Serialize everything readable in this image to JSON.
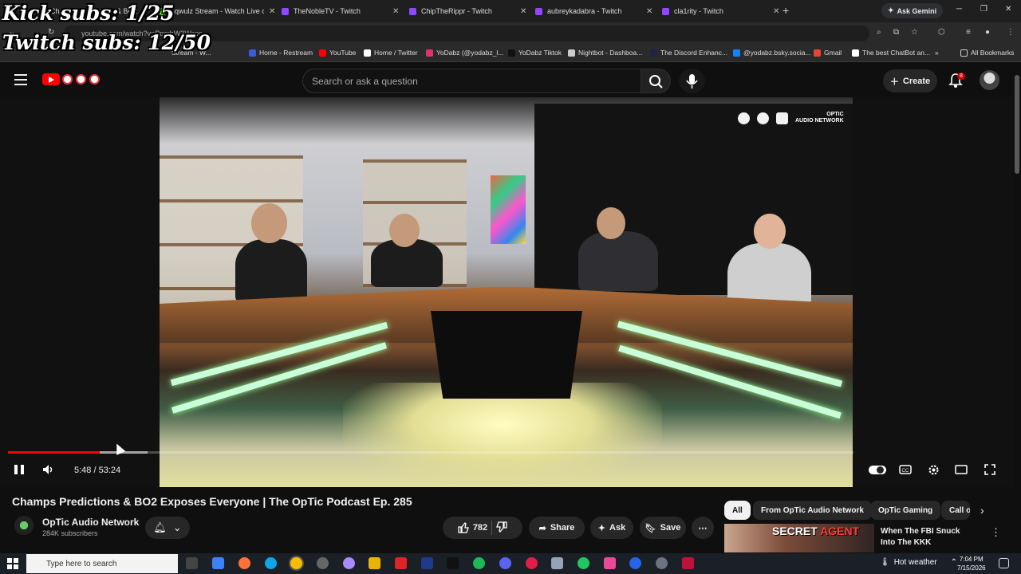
{
  "overlay": {
    "kick_subs": "Kick subs: 1/25",
    "twitch_subs": "Twitch subs: 12/50"
  },
  "browser": {
    "tabs": [
      {
        "label": "Champs Predictions & BO2 ..."
      },
      {
        "label": "Sqwulz Stream - Watch Live on"
      },
      {
        "label": "TheNobleTV - Twitch"
      },
      {
        "label": "ChipTheRippr - Twitch"
      },
      {
        "label": "aubreykadabra - Twitch"
      },
      {
        "label": "cla1rity - Twitch"
      }
    ],
    "new_tab": "+",
    "gemini_label": "Ask Gemini",
    "url": "youtube.com/watch?v=PqcrbW3Wsco",
    "bookmarks": [
      {
        "label": "Home - Restream",
        "color": "#3b5bdb"
      },
      {
        "label": "YouTube",
        "color": "#ff0000"
      },
      {
        "label": "Home / Twitter",
        "color": "#ffffff"
      },
      {
        "label": "YoDabz (@yodabz_l...",
        "color": "#e1306c"
      },
      {
        "label": "YoDabz Tiktok",
        "color": "#111111"
      },
      {
        "label": "Nightbot - Dashboa...",
        "color": "#cccccc"
      },
      {
        "label": "The Discord Enhanc...",
        "color": "#222244"
      },
      {
        "label": "@yodabz.bsky.socia...",
        "color": "#1185fe"
      },
      {
        "label": "Gmail",
        "color": "#ea4335"
      },
      {
        "label": "The best ChatBot an...",
        "color": "#ffffff"
      }
    ],
    "bookmark_partial": "Stream - W...",
    "all_bookmarks": "All Bookmarks"
  },
  "youtube": {
    "search_placeholder": "Search or ask a question",
    "create_label": "Create",
    "notification_count": "8",
    "player": {
      "current_time": "5:48",
      "duration": "53:24",
      "time_display": "5:48 / 53:24",
      "progress_fraction": 0.1086,
      "watermark": "OPTIC\nAUDIO NETWORK"
    },
    "video_title": "Champs Predictions & BO2 Exposes Everyone | The OpTic Podcast Ep. 285",
    "channel": {
      "name": "OpTic Audio Network",
      "subscribers": "284K subscribers"
    },
    "likes": "782",
    "share_label": "Share",
    "ask_label": "Ask",
    "save_label": "Save",
    "chips": [
      {
        "label": "All",
        "active": true
      },
      {
        "label": "From OpTic Audio Network",
        "active": false
      },
      {
        "label": "OpTic Gaming",
        "active": false
      },
      {
        "label": "Call o",
        "active": false
      }
    ],
    "recommendation": {
      "thumb_text_1": "SECRET",
      "thumb_text_2": "AGENT",
      "title": "When The FBI Snuck Into The KKK"
    }
  },
  "taskbar": {
    "search_placeholder": "Type here to search",
    "weather": "Hot weather",
    "time": "7:04 PM",
    "date": "7/15/2026"
  }
}
